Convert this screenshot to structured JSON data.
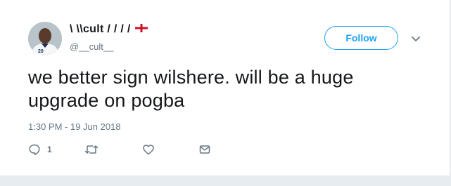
{
  "tweet": {
    "display_name": "\\ \\\\cult / / / /",
    "handle": "@__cult__",
    "text": "we better sign wilshere. will be a huge upgrade on pogba",
    "timestamp": "1:30 PM - 19 Jun 2018",
    "avatar_jersey_number": "20"
  },
  "follow_button": {
    "label": "Follow"
  },
  "actions": {
    "reply_count": "1",
    "reply_icon": "reply-icon",
    "retweet_icon": "retweet-icon",
    "like_icon": "heart-icon",
    "dm_icon": "envelope-icon"
  },
  "colors": {
    "accent": "#1da1f2",
    "text": "#14171a",
    "secondary": "#657786",
    "background": "#e6ecf0",
    "flag_red": "#ce1124"
  }
}
